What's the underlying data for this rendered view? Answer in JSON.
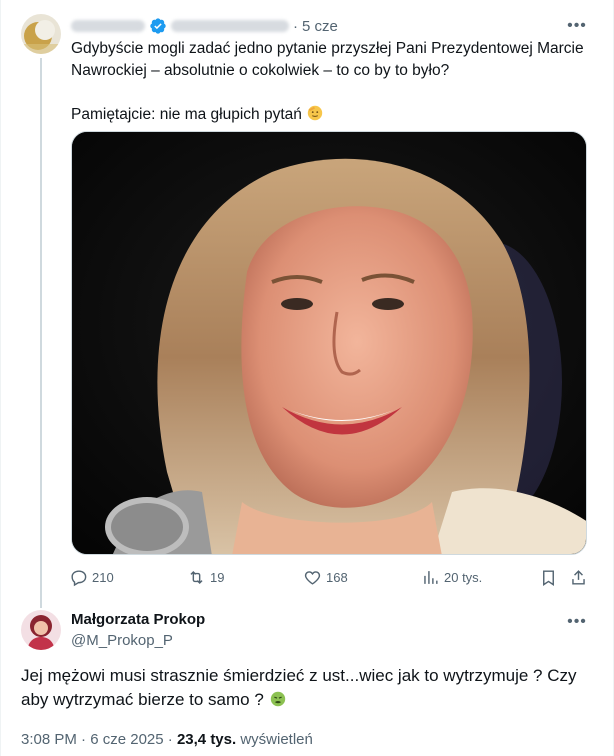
{
  "original_tweet": {
    "time_ago": "5 cze",
    "text_line_1": "Gdybyście mogli zadać jedno pytanie przyszłej Pani Prezydentowej Marcie Nawrockiej – absolutnie o cokolwiek – to co by to było?",
    "text_line_2": "Pamiętajcie: nie ma głupich pytań",
    "text_line_2_emoji": "saluting-face-emoji",
    "more_icon": "more-horizontal-icon",
    "stats": {
      "replies": "210",
      "retweets": "19",
      "likes": "168",
      "views": "20 tys."
    },
    "icons": {
      "reply": "reply-icon",
      "retweet": "retweet-icon",
      "like": "heart-icon",
      "views": "views-icon",
      "bookmark": "bookmark-icon",
      "share": "share-icon"
    }
  },
  "reply": {
    "display_name": "Małgorzata Prokop",
    "handle": "@M_Prokop_P",
    "text": "Jej mężowi musi strasznie śmierdzieć z ust...wiec jak to wytrzymuje ? Czy aby wytrzymać bierze to samo ?",
    "emoji": "nauseated-face-emoji",
    "time": "3:08 PM",
    "separator": "·",
    "date": "6 cze 2025",
    "views_count": "23,4 tys.",
    "views_label": "wyświetleń"
  },
  "colors": {
    "text": "#0f1419",
    "secondary": "#536471",
    "verified": "#1d9bf0",
    "border": "#cfd9de"
  }
}
